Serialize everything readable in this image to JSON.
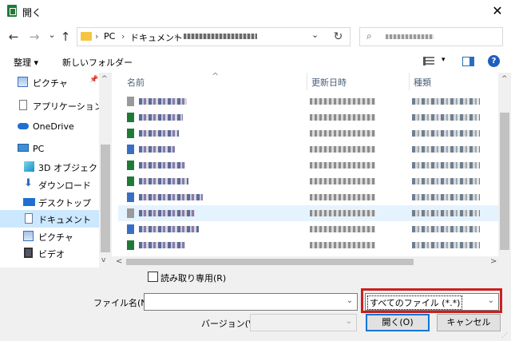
{
  "window": {
    "title": "開く",
    "close_label": "✕"
  },
  "nav_buttons": {
    "back": "←",
    "forward": "→",
    "recent": "⌄",
    "up": "↑"
  },
  "address": {
    "crumbs": [
      "PC",
      "ドキュメント"
    ],
    "separator": "›",
    "dropdown": "⌄",
    "refresh": "↻"
  },
  "search": {
    "icon": "⌕"
  },
  "toolbar": {
    "organize_label": "整理 ▾",
    "new_folder_label": "新しいフォルダー",
    "view_dropdown": "▾",
    "help_label": "?"
  },
  "sidebar": {
    "items": [
      {
        "label": "ピクチャ",
        "icon": "pictures-icon",
        "pinned": "📌"
      },
      {
        "label": "アプリケーション リンク",
        "icon": "app-link-icon"
      },
      {
        "label": "OneDrive",
        "icon": "cloud-icon"
      },
      {
        "label": "PC",
        "icon": "computer-icon"
      },
      {
        "label": "3D オブジェクト",
        "icon": "3d-objects-icon"
      },
      {
        "label": "ダウンロード",
        "icon": "download-icon"
      },
      {
        "label": "デスクトップ",
        "icon": "desktop-icon"
      },
      {
        "label": "ドキュメント",
        "icon": "documents-icon",
        "selected": true
      },
      {
        "label": "ピクチャ",
        "icon": "pictures-icon"
      },
      {
        "label": "ビデオ",
        "icon": "video-icon"
      }
    ]
  },
  "file_list": {
    "columns": {
      "name": "名前",
      "date": "更新日時",
      "type": "種類"
    },
    "sort_indicator": "^"
  },
  "scroll": {
    "up": "^",
    "down": "v",
    "left": "<",
    "right": ">"
  },
  "options": {
    "readonly_label": "読み取り専用(R)"
  },
  "form": {
    "filename_label": "ファイル名(N):",
    "filename_value": "",
    "filetype_value": "すべてのファイル (*.*)",
    "version_label": "バージョン(V):",
    "dropdown": "⌄"
  },
  "buttons": {
    "open": "開く(O)",
    "cancel": "キャンセル"
  },
  "colors": {
    "highlight_border": "#cc1f1f",
    "selection": "#cce8ff",
    "accent": "#0078d7"
  }
}
